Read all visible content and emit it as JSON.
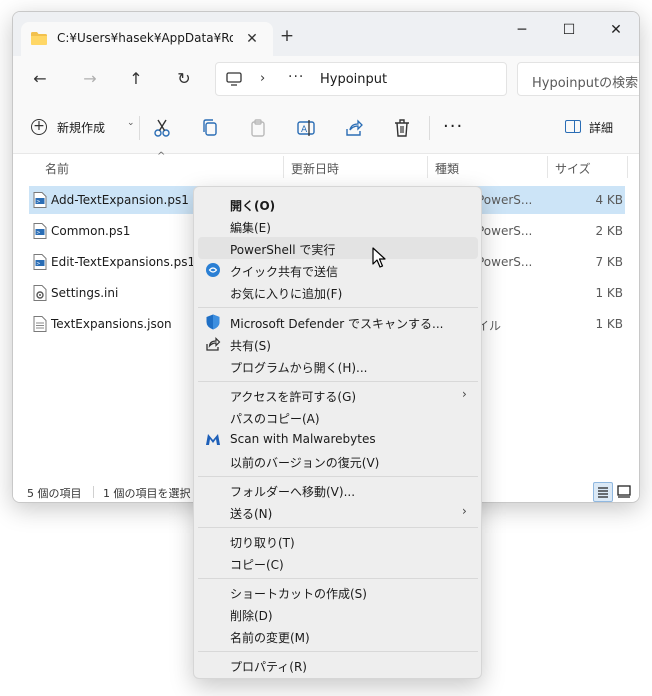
{
  "titlebar": {
    "tab_label": "C:¥Users¥hasek¥AppData¥Roaming",
    "tab_close": "✕",
    "new_tab": "+",
    "minimize": "─",
    "maximize": "☐",
    "close": "✕"
  },
  "nav": {
    "back": "←",
    "forward": "→",
    "up": "↑",
    "refresh": "↻",
    "breadcrumb_sep": "›",
    "breadcrumb_overflow": "···",
    "path": "Hypoinput",
    "search_placeholder": "Hypoinputの検索"
  },
  "toolbar": {
    "new_label": "新規作成",
    "new_chevron": "⌄",
    "more": "···",
    "details_label": "詳細"
  },
  "columns": {
    "name": "名前",
    "date": "更新日時",
    "type": "種類",
    "size": "サイズ"
  },
  "files": [
    {
      "name": "Add-TextExpansion.ps1",
      "type": "Windows PowerS...",
      "type_visible": "PowerS...",
      "size": "4 KB",
      "icon": "ps1-file-icon"
    },
    {
      "name": "Common.ps1",
      "type_visible": "PowerS...",
      "size": "2 KB",
      "icon": "ps1-file-icon"
    },
    {
      "name": "Edit-TextExpansions.ps1",
      "type_visible": "PowerS...",
      "size": "7 KB",
      "icon": "ps1-file-icon"
    },
    {
      "name": "Settings.ini",
      "type_visible": "",
      "size": "1 KB",
      "icon": "settings-file-icon"
    },
    {
      "name": "TextExpansions.json",
      "type_visible": "イル",
      "size": "1 KB",
      "icon": "text-file-icon"
    }
  ],
  "status": {
    "item_count": "5 個の項目",
    "selected": "1 個の項目を選択"
  },
  "context_menu": {
    "open": "開く(O)",
    "edit": "編集(E)",
    "run_powershell": "PowerShell で実行",
    "nearby_share": "クイック共有で送信",
    "add_favorites": "お気に入りに追加(F)",
    "defender_scan": "Microsoft Defender でスキャンする...",
    "share": "共有(S)",
    "open_with": "プログラムから開く(H)...",
    "give_access": "アクセスを許可する(G)",
    "copy_path": "パスのコピー(A)",
    "malwarebytes": "Scan with Malwarebytes",
    "restore_versions": "以前のバージョンの復元(V)",
    "move_to_folder": "フォルダーへ移動(V)...",
    "send_to": "送る(N)",
    "cut": "切り取り(T)",
    "copy": "コピー(C)",
    "create_shortcut": "ショートカットの作成(S)",
    "delete": "削除(D)",
    "rename": "名前の変更(M)",
    "properties": "プロパティ(R)",
    "submenu_arrow": "›"
  },
  "colors": {
    "accent": "#0067c0",
    "selection": "#cce4f7",
    "titlebar_bg": "#eef0f3",
    "menu_bg": "#eeeeee"
  }
}
